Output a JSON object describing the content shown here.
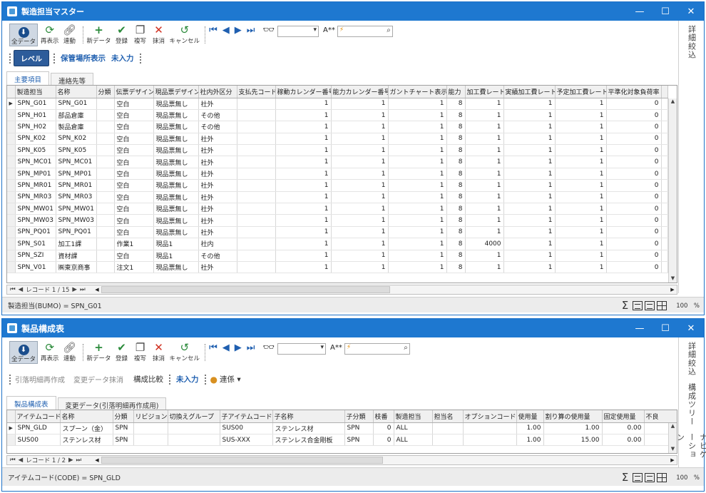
{
  "w1": {
    "title": "製造担当マスター",
    "toolbar": [
      {
        "label": "全データ",
        "icon": "download-icon"
      },
      {
        "label": "再表示",
        "icon": "refresh-icon"
      },
      {
        "label": "連動",
        "icon": "link-icon"
      },
      {
        "label": "新データ",
        "icon": "plus-icon"
      },
      {
        "label": "登録",
        "icon": "check-icon"
      },
      {
        "label": "複写",
        "icon": "copy-icon"
      },
      {
        "label": "抹消",
        "icon": "delete-icon"
      },
      {
        "label": "キャンセル",
        "icon": "undo-icon"
      }
    ],
    "font_label": "A**",
    "search_value": "⚡",
    "secbar": {
      "pill": "レベル",
      "link1": "保管場所表示",
      "link2": "未入力"
    },
    "right_tabs": [
      "詳細絞込"
    ],
    "tabs": [
      "主要項目",
      "連絡先等"
    ],
    "columns": [
      "製造担当",
      "名称",
      "分類",
      "伝票デザイン",
      "現品票デザイン",
      "社内外区分",
      "支払先コード",
      "稼動カレンダー番号",
      "能力カレンダー番号",
      "ガントチャート表示順",
      "能力",
      "加工費レート",
      "実績加工費レート",
      "予定加工費レート",
      "平準化対象負荷率"
    ],
    "rows": [
      [
        "SPN_G01",
        "SPN_G01",
        "",
        "空白",
        "現品票無し",
        "社外",
        "",
        "1",
        "1",
        "1",
        "8",
        "1",
        "1",
        "1",
        "0"
      ],
      [
        "SPN_H01",
        "部品倉庫",
        "",
        "空白",
        "現品票無し",
        "その他",
        "",
        "1",
        "1",
        "1",
        "8",
        "1",
        "1",
        "1",
        "0"
      ],
      [
        "SPN_H02",
        "製品倉庫",
        "",
        "空白",
        "現品票無し",
        "その他",
        "",
        "1",
        "1",
        "1",
        "8",
        "1",
        "1",
        "1",
        "0"
      ],
      [
        "SPN_K02",
        "SPN_K02",
        "",
        "空白",
        "現品票無し",
        "社外",
        "",
        "1",
        "1",
        "1",
        "8",
        "1",
        "1",
        "1",
        "0"
      ],
      [
        "SPN_K05",
        "SPN_K05",
        "",
        "空白",
        "現品票無し",
        "社外",
        "",
        "1",
        "1",
        "1",
        "8",
        "1",
        "1",
        "1",
        "0"
      ],
      [
        "SPN_MC01",
        "SPN_MC01",
        "",
        "空白",
        "現品票無し",
        "社外",
        "",
        "1",
        "1",
        "1",
        "8",
        "1",
        "1",
        "1",
        "0"
      ],
      [
        "SPN_MP01",
        "SPN_MP01",
        "",
        "空白",
        "現品票無し",
        "社外",
        "",
        "1",
        "1",
        "1",
        "8",
        "1",
        "1",
        "1",
        "0"
      ],
      [
        "SPN_MR01",
        "SPN_MR01",
        "",
        "空白",
        "現品票無し",
        "社外",
        "",
        "1",
        "1",
        "1",
        "8",
        "1",
        "1",
        "1",
        "0"
      ],
      [
        "SPN_MR03",
        "SPN_MR03",
        "",
        "空白",
        "現品票無し",
        "社外",
        "",
        "1",
        "1",
        "1",
        "8",
        "1",
        "1",
        "1",
        "0"
      ],
      [
        "SPN_MW01",
        "SPN_MW01",
        "",
        "空白",
        "現品票無し",
        "社外",
        "",
        "1",
        "1",
        "1",
        "8",
        "1",
        "1",
        "1",
        "0"
      ],
      [
        "SPN_MW03",
        "SPN_MW03",
        "",
        "空白",
        "現品票無し",
        "社外",
        "",
        "1",
        "1",
        "1",
        "8",
        "1",
        "1",
        "1",
        "0"
      ],
      [
        "SPN_PQ01",
        "SPN_PQ01",
        "",
        "空白",
        "現品票無し",
        "社外",
        "",
        "1",
        "1",
        "1",
        "8",
        "1",
        "1",
        "1",
        "0"
      ],
      [
        "SPN_S01",
        "加工1課",
        "",
        "作業1",
        "現品1",
        "社内",
        "",
        "1",
        "1",
        "1",
        "8",
        "4000",
        "1",
        "1",
        "0"
      ],
      [
        "SPN_SZI",
        "資材課",
        "",
        "空白",
        "現品1",
        "その他",
        "",
        "1",
        "1",
        "1",
        "8",
        "1",
        "1",
        "1",
        "0"
      ],
      [
        "SPN_V01",
        "㈱東京商事",
        "",
        "注文1",
        "現品票無し",
        "社外",
        "",
        "1",
        "1",
        "1",
        "8",
        "1",
        "1",
        "1",
        "0"
      ]
    ],
    "pager": "レコード 1 / 15",
    "status": "製造担当(BUMO) = SPN_G01",
    "zoom": "100　%"
  },
  "w2": {
    "title": "製品構成表",
    "toolbar": [
      {
        "label": "全データ",
        "icon": "download-icon"
      },
      {
        "label": "再表示",
        "icon": "refresh-icon"
      },
      {
        "label": "連動",
        "icon": "link-icon"
      },
      {
        "label": "新データ",
        "icon": "plus-icon"
      },
      {
        "label": "登録",
        "icon": "check-icon"
      },
      {
        "label": "複写",
        "icon": "copy-icon"
      },
      {
        "label": "抹消",
        "icon": "delete-icon"
      },
      {
        "label": "キャンセル",
        "icon": "undo-icon"
      }
    ],
    "font_label": "A**",
    "search_value": "⚡",
    "secbar": {
      "g1": "引落明細再作成",
      "g2": "変更データ抹消",
      "link0": "構成比較",
      "link1": "未入力",
      "link2": "連係 ▾"
    },
    "right_tabs": [
      "詳細絞込",
      "構成ツリー",
      "ナビゲーション"
    ],
    "tabs": [
      "製品構成表",
      "変更データ(引落明細再作成用)"
    ],
    "columns": [
      "アイテムコード",
      "名称",
      "分類",
      "リビジョン",
      "切換えグループ",
      "子アイテムコード",
      "子名称",
      "子分類",
      "枝番",
      "製造担当",
      "担当名",
      "オプションコード",
      "使用量",
      "割り算の使用量",
      "固定使用量",
      "不良"
    ],
    "rows": [
      [
        "SPN_GLD",
        "スプーン（金）",
        "SPN",
        "",
        "",
        "SUS00",
        "ステンレス材",
        "SPN",
        "0",
        "ALL",
        "",
        "",
        "1.00",
        "1.00",
        "0.00",
        "0"
      ],
      [
        "SUS00",
        "ステンレス材",
        "SPN",
        "",
        "",
        "SUS-XXX",
        "ステンレス合金剛板",
        "SPN",
        "0",
        "ALL",
        "",
        "",
        "1.00",
        "15.00",
        "0.00",
        "0"
      ]
    ],
    "pager": "レコード 1 / 2",
    "status": "アイテムコード(CODE) = SPN_GLD",
    "zoom": "100　%"
  }
}
